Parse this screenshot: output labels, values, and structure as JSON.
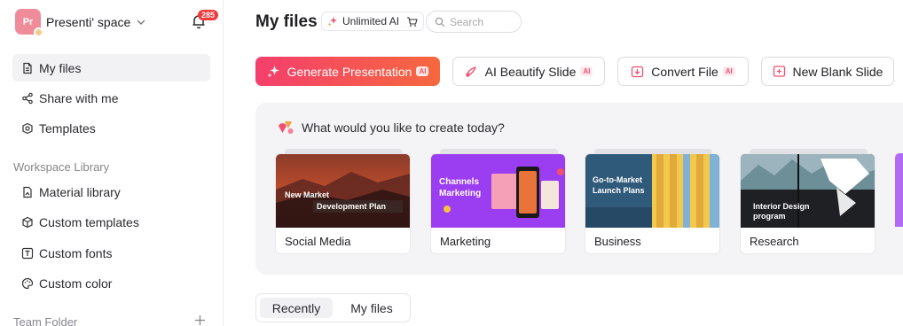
{
  "workspace": {
    "avatar_initials": "Pr",
    "name": "Presenti' space",
    "notifications": "285"
  },
  "sidebar": {
    "items": [
      {
        "label": "My files",
        "icon": "file-icon"
      },
      {
        "label": "Share with me",
        "icon": "share-icon"
      },
      {
        "label": "Templates",
        "icon": "templates-icon"
      }
    ],
    "library_label": "Workspace Library",
    "library_items": [
      {
        "label": "Material library",
        "icon": "image-icon"
      },
      {
        "label": "Custom templates",
        "icon": "cube-icon"
      },
      {
        "label": "Custom fonts",
        "icon": "font-icon"
      },
      {
        "label": "Custom color",
        "icon": "palette-icon"
      }
    ],
    "team_label": "Team Folder"
  },
  "header": {
    "title": "My files",
    "plan_label": "Unlimited AI",
    "search_placeholder": "Search"
  },
  "actions": {
    "generate": "Generate Presentation",
    "beautify": "AI Beautify Slide",
    "convert": "Convert File",
    "new_blank": "New Blank Slide",
    "ai_tag": "AI"
  },
  "create": {
    "title": "What would you like to create today?",
    "cards": [
      {
        "label": "Social Media",
        "thumb_line1": "New Market",
        "thumb_line2": "Development Plan"
      },
      {
        "label": "Marketing",
        "thumb_line1": "Channels",
        "thumb_line2": "Marketing"
      },
      {
        "label": "Business",
        "thumb_line1": "Go-to-Market",
        "thumb_line2": "Launch Plans"
      },
      {
        "label": "Research",
        "thumb_line1": "Interior Design",
        "thumb_line2": "program"
      }
    ]
  },
  "tabs": {
    "recently": "Recently",
    "my_files": "My files"
  },
  "colors": {
    "accent_start": "#f43f6c",
    "accent_end": "#f6683f",
    "badge": "#ef3b3b"
  }
}
